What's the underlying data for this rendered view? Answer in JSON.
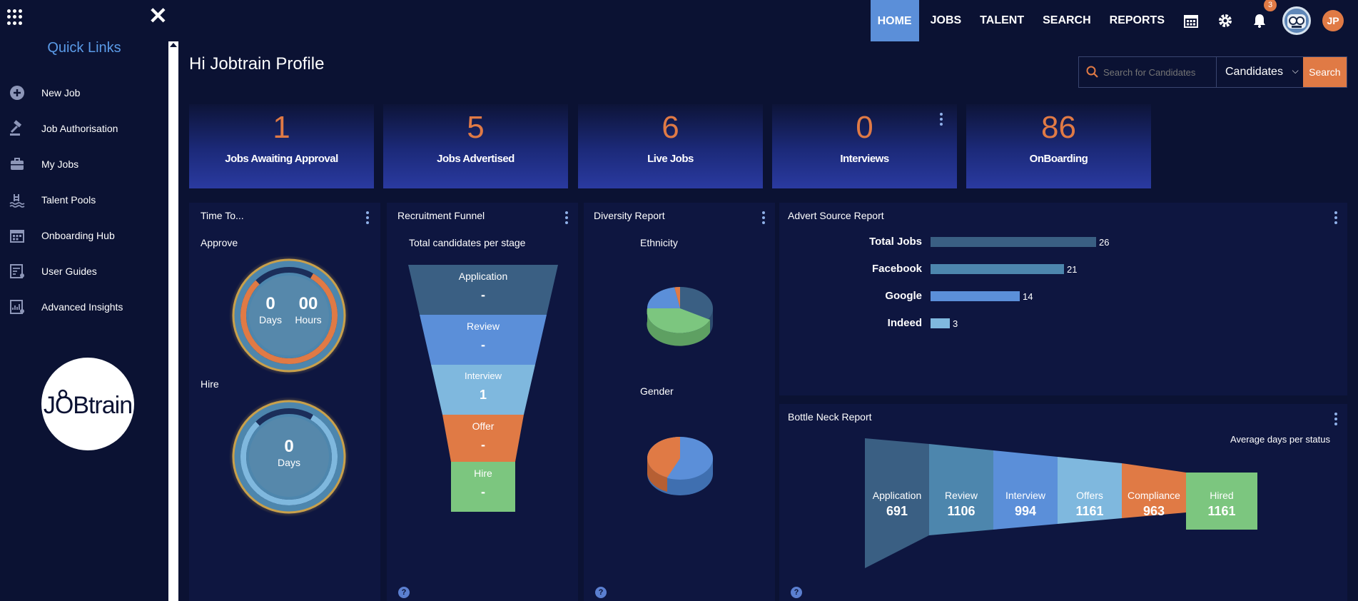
{
  "nav": {
    "items": [
      "HOME",
      "JOBS",
      "TALENT",
      "SEARCH",
      "REPORTS"
    ],
    "notification_count": "3",
    "user_initials": "JP"
  },
  "sidebar": {
    "title": "Quick Links",
    "items": [
      {
        "label": "New Job",
        "icon": "plus-circle-icon"
      },
      {
        "label": "Job Authorisation",
        "icon": "gavel-icon"
      },
      {
        "label": "My Jobs",
        "icon": "briefcase-icon"
      },
      {
        "label": "Talent Pools",
        "icon": "swimmer-icon"
      },
      {
        "label": "Onboarding Hub",
        "icon": "calendar-icon"
      },
      {
        "label": "User Guides",
        "icon": "guide-icon"
      },
      {
        "label": "Advanced Insights",
        "icon": "insights-icon"
      }
    ],
    "logo_text": "JOBtrain"
  },
  "greeting": "Hi Jobtrain Profile",
  "search": {
    "placeholder": "Search for Candidates",
    "select_value": "Candidates",
    "button": "Search"
  },
  "stats": [
    {
      "value": "1",
      "label": "Jobs Awaiting Approval"
    },
    {
      "value": "5",
      "label": "Jobs Advertised"
    },
    {
      "value": "6",
      "label": "Live Jobs"
    },
    {
      "value": "0",
      "label": "Interviews"
    },
    {
      "value": "86",
      "label": "OnBoarding"
    }
  ],
  "time_to": {
    "title": "Time To...",
    "approve_label": "Approve",
    "approve_days": "0",
    "approve_hours": "00",
    "days_unit": "Days",
    "hours_unit": "Hours",
    "hire_label": "Hire",
    "hire_days": "0"
  },
  "funnel": {
    "title": "Recruitment Funnel",
    "subtitle": "Total candidates per stage",
    "stages": [
      {
        "name": "Application",
        "value": "-"
      },
      {
        "name": "Review",
        "value": "-"
      },
      {
        "name": "Interview",
        "value": "1"
      },
      {
        "name": "Offer",
        "value": "-"
      },
      {
        "name": "Hire",
        "value": "-"
      }
    ]
  },
  "diversity": {
    "title": "Diversity Report",
    "ethnicity_label": "Ethnicity",
    "gender_label": "Gender"
  },
  "advert": {
    "title": "Advert Source Report",
    "rows": [
      {
        "label": "Total Jobs",
        "value": 26,
        "color": "#3a5f83"
      },
      {
        "label": "Facebook",
        "value": 21,
        "color": "#4d86ad"
      },
      {
        "label": "Google",
        "value": 14,
        "color": "#5b8fd9"
      },
      {
        "label": "Indeed",
        "value": 3,
        "color": "#7fb8de"
      }
    ]
  },
  "bottleneck": {
    "title": "Bottle Neck Report",
    "subtitle": "Average days per status",
    "stages": [
      {
        "name": "Application",
        "value": "691",
        "color": "#3a5f83"
      },
      {
        "name": "Review",
        "value": "1106",
        "color": "#4d86ad"
      },
      {
        "name": "Interview",
        "value": "994",
        "color": "#5b8fd9"
      },
      {
        "name": "Offers",
        "value": "1161",
        "color": "#7fb8de"
      },
      {
        "name": "Compliance",
        "value": "963",
        "color": "#e07a45"
      },
      {
        "name": "Hired",
        "value": "1161",
        "color": "#7cc67f"
      }
    ]
  },
  "colors": {
    "accent": "#e07a45",
    "nav_active": "#5b8fd9",
    "background": "#0b1233"
  }
}
